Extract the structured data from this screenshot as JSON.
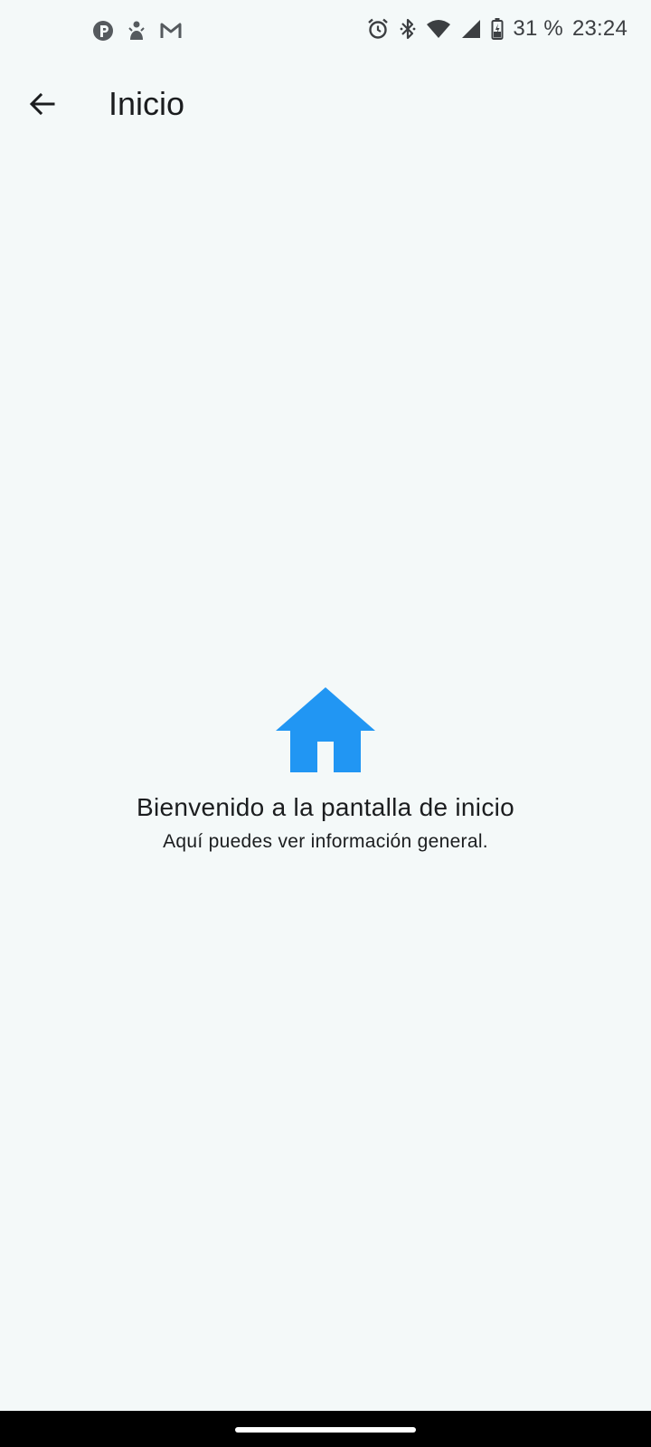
{
  "status_bar": {
    "battery": "31 %",
    "time": "23:24",
    "left_icons": [
      "pinterest-like-icon",
      "figure-icon",
      "gmail-icon"
    ],
    "right_icons": [
      "alarm-icon",
      "bluetooth-icon",
      "wifi-icon",
      "cell-signal-icon",
      "battery-charging-icon"
    ]
  },
  "app_bar": {
    "title": "Inicio",
    "back_icon": "arrow-back-icon"
  },
  "content": {
    "icon": "home-icon",
    "title": "Bienvenido a la pantalla de inicio",
    "subtitle": "Aquí puedes ver información general."
  },
  "colors": {
    "background": "#F4F9F9",
    "accent": "#2196F3",
    "text": "#1B1D1F",
    "nav_bar": "#000000"
  }
}
